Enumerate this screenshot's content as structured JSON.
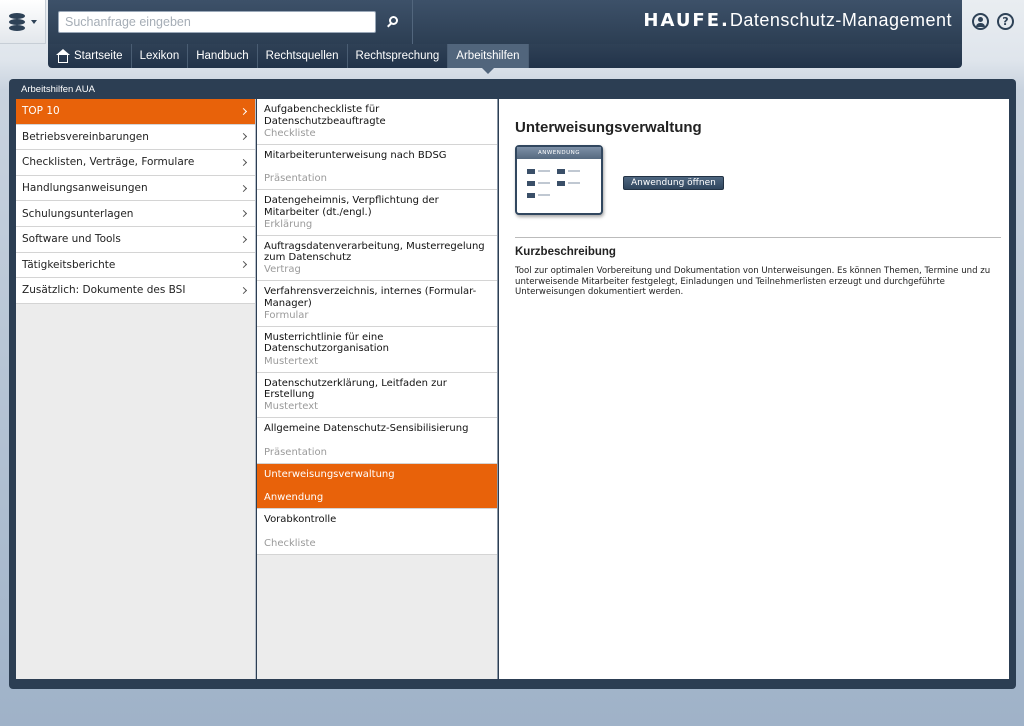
{
  "header": {
    "search_placeholder": "Suchanfrage eingeben",
    "brand_logo": "HAUFE.",
    "brand_suffix": "Datenschutz-Management",
    "help_symbol": "?"
  },
  "nav": {
    "items": [
      {
        "label": "Startseite"
      },
      {
        "label": "Lexikon"
      },
      {
        "label": "Handbuch"
      },
      {
        "label": "Rechtsquellen"
      },
      {
        "label": "Rechtsprechung"
      },
      {
        "label": "Arbeitshilfen"
      }
    ],
    "active": "Arbeitshilfen"
  },
  "panel": {
    "title": "Arbeitshilfen AUA"
  },
  "categories": [
    {
      "label": "TOP 10",
      "active": true
    },
    {
      "label": "Betriebsvereinbarungen"
    },
    {
      "label": "Checklisten, Verträge, Formulare"
    },
    {
      "label": "Handlungsanweisungen"
    },
    {
      "label": "Schulungsunterlagen"
    },
    {
      "label": "Software und Tools"
    },
    {
      "label": "Tätigkeitsberichte"
    },
    {
      "label": "Zusätzlich: Dokumente des BSI"
    }
  ],
  "documents": [
    {
      "title": "Aufgabencheckliste für Datenschutzbeauftragte",
      "type": "Checkliste"
    },
    {
      "title": "Mitarbeiterunterweisung nach BDSG",
      "type": "Präsentation"
    },
    {
      "title": "Datengeheimnis, Verpflichtung der Mitarbeiter (dt./engl.)",
      "type": "Erklärung"
    },
    {
      "title": "Auftragsdatenverarbeitung, Musterregelung zum Datenschutz",
      "type": "Vertrag"
    },
    {
      "title": "Verfahrensverzeichnis, internes (Formular-Manager)",
      "type": "Formular"
    },
    {
      "title": "Musterrichtlinie für eine Datenschutzorganisation",
      "type": "Mustertext"
    },
    {
      "title": "Datenschutzerklärung, Leitfaden zur Erstellung",
      "type": "Mustertext"
    },
    {
      "title": "Allgemeine Datenschutz-Sensibilisierung",
      "type": "Präsentation"
    },
    {
      "title": "Unterweisungsverwaltung",
      "type": "Anwendung",
      "active": true
    },
    {
      "title": "Vorabkontrolle",
      "type": "Checkliste"
    }
  ],
  "detail": {
    "title": "Unterweisungsverwaltung",
    "thumb_label": "ANWENDUNG",
    "open_button": "Anwendung öffnen",
    "kurz_heading": "Kurzbeschreibung",
    "kurz_text": "Tool zur optimalen Vorbereitung und Dokumentation von Unterweisungen. Es können Themen, Termine und zu unterweisende Mitarbeiter festgelegt, Einladungen und Teilnehmerlisten erzeugt und durchgeführte Unterweisungen dokumentiert werden."
  },
  "colors": {
    "accent": "#e8620a",
    "header_bg": "#2c3e53"
  }
}
